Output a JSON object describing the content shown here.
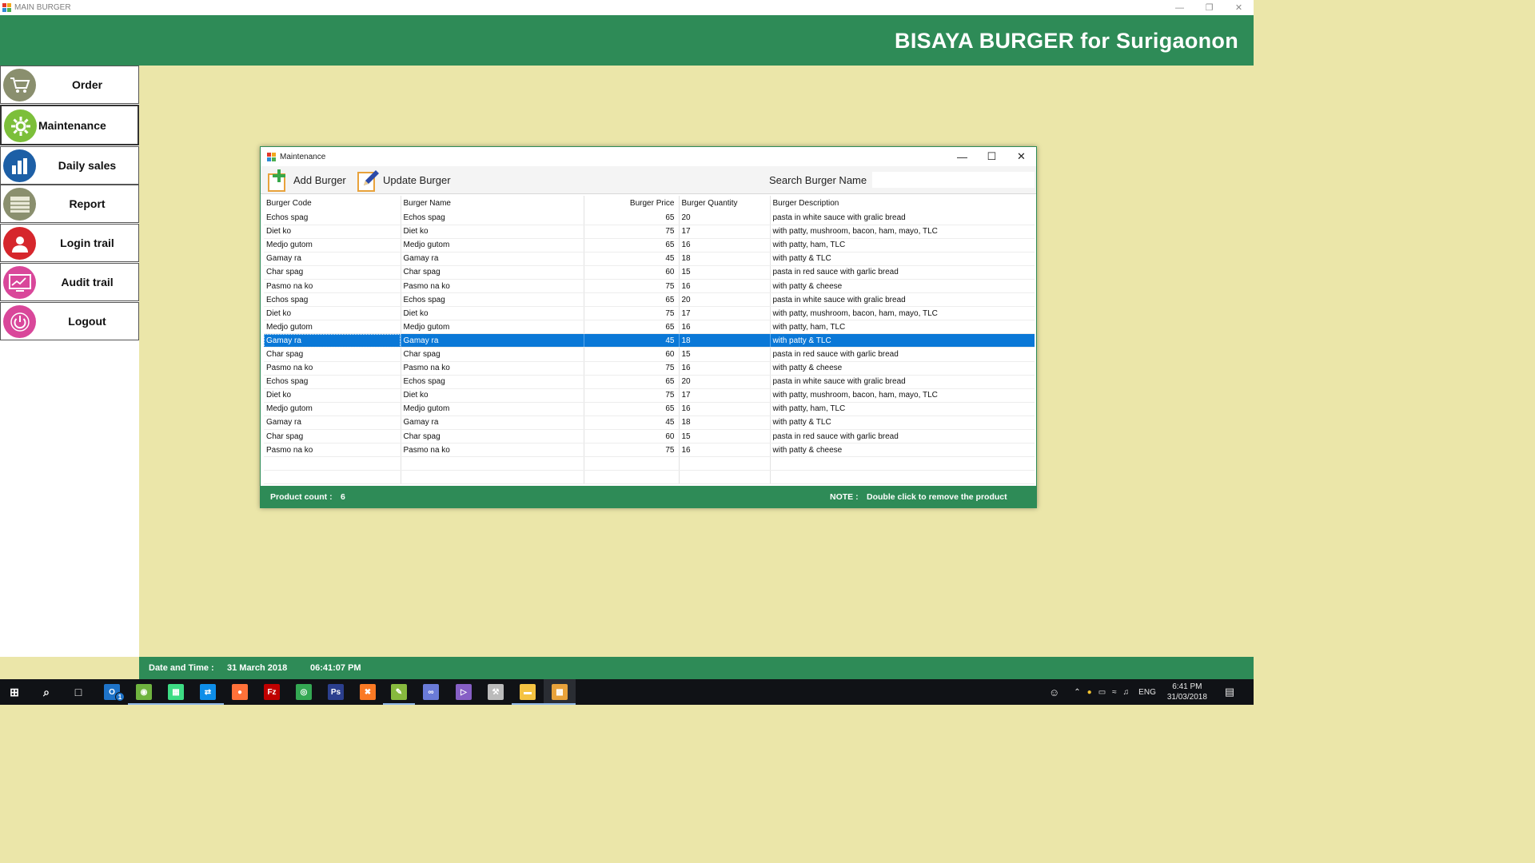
{
  "window": {
    "title": "MAIN BURGER",
    "controls": [
      "—",
      "❐",
      "✕"
    ]
  },
  "header": {
    "brand": "BISAYA BURGER for Surigaonon"
  },
  "sidebar": {
    "items": [
      {
        "label": "Order",
        "icon": "cart-icon",
        "color": "#8a8f6e"
      },
      {
        "label": "Maintenance",
        "icon": "gear-icon",
        "color": "#7cbf3a"
      },
      {
        "label": "Daily sales",
        "icon": "bar-chart-icon",
        "color": "#1d5fa6"
      },
      {
        "label": "Report",
        "icon": "list-icon",
        "color": "#8a8f6e"
      },
      {
        "label": "Login trail",
        "icon": "user-icon",
        "color": "#d6262c"
      },
      {
        "label": "Audit trail",
        "icon": "monitor-chart-icon",
        "color": "#d9479a"
      },
      {
        "label": "Logout",
        "icon": "power-icon",
        "color": "#d9479a"
      }
    ],
    "active": "Maintenance"
  },
  "maintenance": {
    "title": "Maintenance",
    "add_label": "Add Burger",
    "update_label": "Update Burger",
    "search_label": "Search Burger Name",
    "search_value": "",
    "columns": [
      "Burger Code",
      "Burger Name",
      "Burger Price",
      "Burger Quantity",
      "Burger Description"
    ],
    "rows": [
      [
        "Echos spag",
        "Echos spag",
        "65",
        "20",
        "pasta in white sauce with gralic bread"
      ],
      [
        "Diet ko",
        "Diet ko",
        "75",
        "17",
        "with patty, mushroom, bacon, ham, mayo, TLC"
      ],
      [
        "Medjo gutom",
        "Medjo gutom",
        "65",
        "16",
        "with patty, ham, TLC"
      ],
      [
        "Gamay ra",
        "Gamay ra",
        "45",
        "18",
        "with patty & TLC"
      ],
      [
        "Char spag",
        "Char spag",
        "60",
        "15",
        "pasta in red sauce with garlic bread"
      ],
      [
        "Pasmo na ko",
        "Pasmo na ko",
        "75",
        "16",
        "with patty & cheese"
      ],
      [
        "Echos spag",
        "Echos spag",
        "65",
        "20",
        "pasta in white sauce with gralic bread"
      ],
      [
        "Diet ko",
        "Diet ko",
        "75",
        "17",
        "with patty, mushroom, bacon, ham, mayo, TLC"
      ],
      [
        "Medjo gutom",
        "Medjo gutom",
        "65",
        "16",
        "with patty, ham, TLC"
      ],
      [
        "Gamay ra",
        "Gamay ra",
        "45",
        "18",
        "with patty & TLC"
      ],
      [
        "Char spag",
        "Char spag",
        "60",
        "15",
        "pasta in red sauce with garlic bread"
      ],
      [
        "Pasmo na ko",
        "Pasmo na ko",
        "75",
        "16",
        "with patty & cheese"
      ],
      [
        "Echos spag",
        "Echos spag",
        "65",
        "20",
        "pasta in white sauce with gralic bread"
      ],
      [
        "Diet ko",
        "Diet ko",
        "75",
        "17",
        "with patty, mushroom, bacon, ham, mayo, TLC"
      ],
      [
        "Medjo gutom",
        "Medjo gutom",
        "65",
        "16",
        "with patty, ham, TLC"
      ],
      [
        "Gamay ra",
        "Gamay ra",
        "45",
        "18",
        "with patty & TLC"
      ],
      [
        "Char spag",
        "Char spag",
        "60",
        "15",
        "pasta in red sauce with garlic bread"
      ],
      [
        "Pasmo na ko",
        "Pasmo na ko",
        "75",
        "16",
        "with patty & cheese"
      ]
    ],
    "selected_row": 9,
    "product_count_label": "Product count :",
    "product_count": "6",
    "note_label": "NOTE :",
    "note_text": "Double click to remove the product"
  },
  "footer": {
    "datetime_label": "Date and Time :",
    "date": "31 March 2018",
    "time": "06:41:07 PM"
  },
  "taskbar": {
    "apps": [
      {
        "name": "start-icon",
        "color": "#ffffff"
      },
      {
        "name": "search-icon",
        "color": "#ffffff"
      },
      {
        "name": "task-view-icon",
        "color": "#ffffff"
      },
      {
        "name": "outlook-icon",
        "color": "#1e73c8"
      },
      {
        "name": "android-studio-icon",
        "color": "#6fb33f"
      },
      {
        "name": "android-sdk-icon",
        "color": "#3ddc84"
      },
      {
        "name": "teamviewer-icon",
        "color": "#0e8ee9"
      },
      {
        "name": "firefox-icon",
        "color": "#ff7139"
      },
      {
        "name": "filezilla-icon",
        "color": "#bf0000"
      },
      {
        "name": "chrome-icon",
        "color": "#34a853"
      },
      {
        "name": "photoshop-icon",
        "color": "#2b3f8e"
      },
      {
        "name": "xampp-icon",
        "color": "#fb7a24"
      },
      {
        "name": "notepad-plus-icon",
        "color": "#87b93e"
      },
      {
        "name": "infinity-icon",
        "color": "#6a7bd8"
      },
      {
        "name": "visual-studio-icon",
        "color": "#865fc5"
      },
      {
        "name": "tools-icon",
        "color": "#bbbbbb"
      },
      {
        "name": "file-explorer-icon",
        "color": "#f5c342"
      },
      {
        "name": "main-burger-app-icon",
        "color": "#e8a23b"
      }
    ],
    "outlook_badge": "1",
    "language": "ENG",
    "clock_time": "6:41 PM",
    "clock_date": "31/03/2018"
  }
}
